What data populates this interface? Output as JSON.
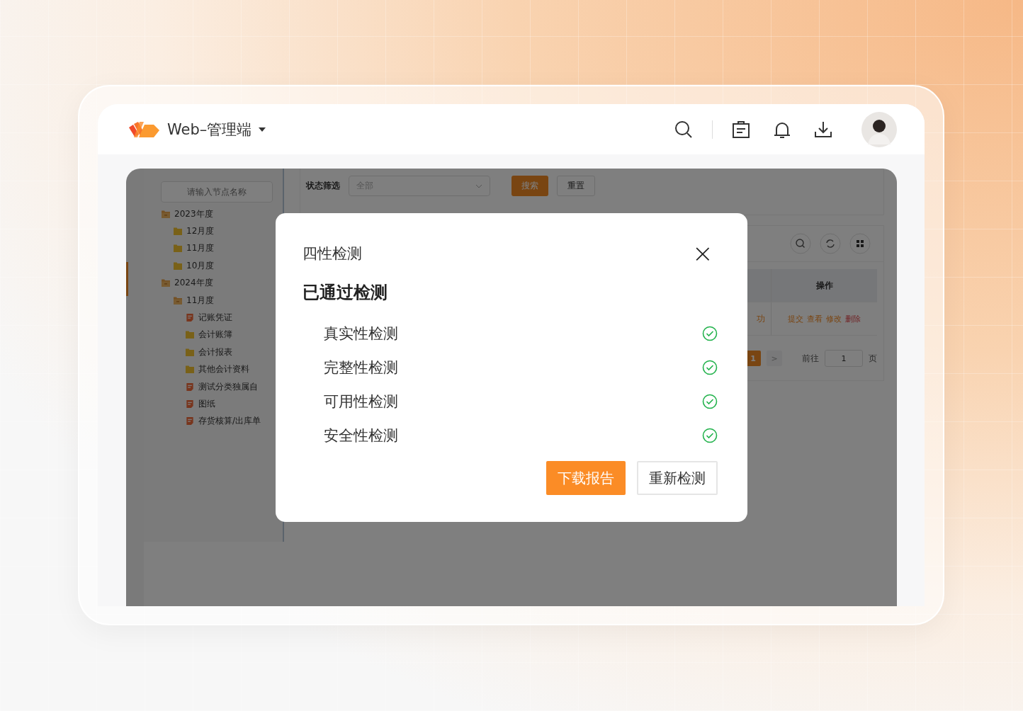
{
  "header": {
    "app_title": "Web–管理端"
  },
  "tree": {
    "placeholder": "请输入节点名称",
    "items": [
      {
        "label": "2023年度",
        "kind": "folder-open",
        "children": [
          {
            "label": "12月度",
            "kind": "folder"
          },
          {
            "label": "11月度",
            "kind": "folder"
          },
          {
            "label": "10月度",
            "kind": "folder"
          }
        ]
      },
      {
        "label": "2024年度",
        "kind": "folder-open",
        "children": [
          {
            "label": "11月度",
            "kind": "folder-open",
            "children": [
              {
                "label": "记账凭证",
                "kind": "doc"
              },
              {
                "label": "会计账簿",
                "kind": "folder"
              },
              {
                "label": "会计报表",
                "kind": "folder"
              },
              {
                "label": "其他会计资料",
                "kind": "folder"
              },
              {
                "label": "测试分类独属自",
                "kind": "doc"
              },
              {
                "label": "图纸",
                "kind": "doc"
              },
              {
                "label": "存货核算/出库单",
                "kind": "doc"
              }
            ]
          }
        ]
      }
    ]
  },
  "filter": {
    "label": "状态筛选",
    "value": "全部",
    "search_button": "搜索",
    "reset_button": "重置"
  },
  "table": {
    "header": "操作",
    "row_status": "功",
    "actions": [
      {
        "label": "提交",
        "kind": "normal"
      },
      {
        "label": "查看",
        "kind": "normal"
      },
      {
        "label": "修改",
        "kind": "normal"
      },
      {
        "label": "删除",
        "kind": "danger"
      }
    ]
  },
  "pagination": {
    "pages": [
      {
        "label": "1",
        "selected": true
      }
    ],
    "next": ">",
    "goto_label": "前往",
    "goto_value": "1",
    "page_unit": "页"
  },
  "dialog": {
    "title": "四性检测",
    "close": "×",
    "heading": "已通过检测",
    "checks": [
      {
        "label": "真实性检测",
        "passed": true
      },
      {
        "label": "完整性检测",
        "passed": true
      },
      {
        "label": "可用性检测",
        "passed": true
      },
      {
        "label": "安全性检测",
        "passed": true
      }
    ],
    "primary_button": "下载报告",
    "secondary_button": "重新检测"
  }
}
